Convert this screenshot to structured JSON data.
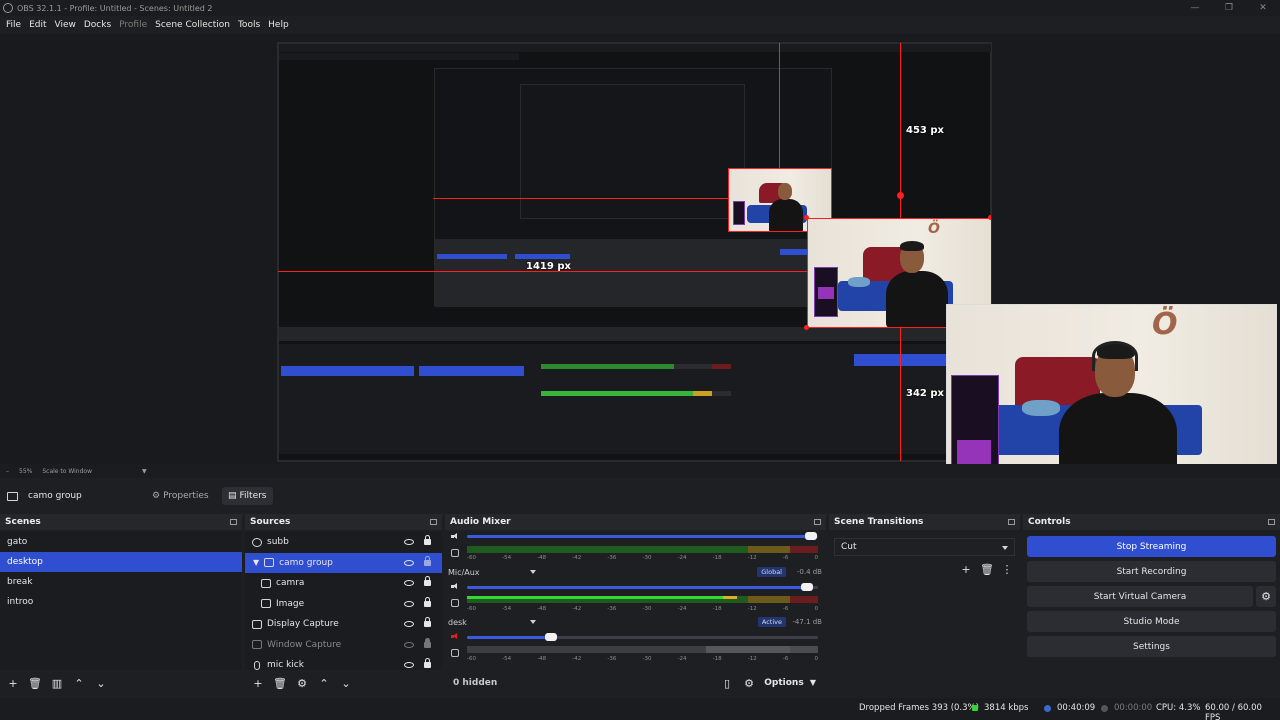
{
  "window": {
    "title": "OBS 32.1.1 - Profile: Untitled - Scenes: Untitled 2",
    "controls": [
      "—",
      "❐",
      "✕"
    ]
  },
  "menu": [
    "File",
    "Edit",
    "View",
    "Docks",
    "Profile",
    "Scene Collection",
    "Tools",
    "Help"
  ],
  "preview": {
    "measure_top": "453 px",
    "measure_left": "1419 px",
    "measure_right": "342 px",
    "zoom": "55%",
    "scale_mode": "Scale to Window"
  },
  "context": {
    "source_name": "camo group",
    "properties_label": "Properties",
    "filters_label": "Filters"
  },
  "scenes": {
    "title": "Scenes",
    "items": [
      "gato",
      "desktop",
      "break",
      "introo"
    ],
    "selected_index": 1
  },
  "sources": {
    "title": "Sources",
    "items": [
      {
        "label": "subb",
        "icon": "browser-icon"
      },
      {
        "label": "camo group",
        "icon": "group-icon"
      },
      {
        "label": "camra",
        "icon": "camera-icon"
      },
      {
        "label": "Image",
        "icon": "image-icon"
      },
      {
        "label": "Display Capture",
        "icon": "monitor-icon"
      },
      {
        "label": "Window Capture",
        "icon": "window-icon"
      },
      {
        "label": "mic kick",
        "icon": "mic-icon"
      }
    ],
    "selected_index": 1
  },
  "audio_mixer": {
    "title": "Audio Mixer",
    "scale": [
      "-60",
      "-54",
      "-48",
      "-42",
      "-36",
      "-30",
      "-24",
      "-18",
      "-12",
      "-6",
      "0"
    ],
    "channels": [
      {
        "name": "",
        "badge": "",
        "db": "",
        "volume": 1.0
      },
      {
        "name": "Mic/Aux",
        "badge": "Global",
        "db": "-0.4 dB",
        "volume": 0.97
      },
      {
        "name": "desk",
        "badge": "Active",
        "db": "-47.1 dB",
        "volume": 0.24
      }
    ],
    "hidden_label": "0 hidden",
    "options_label": "Options"
  },
  "scene_transitions": {
    "title": "Scene Transitions",
    "selected": "Cut"
  },
  "controls": {
    "title": "Controls",
    "buttons": [
      "Stop Streaming",
      "Start Recording",
      "Start Virtual Camera",
      "Studio Mode",
      "Settings"
    ]
  },
  "status": {
    "dropped_frames": "Dropped Frames 393 (0.3%)",
    "bitrate": "3814 kbps",
    "stream_time": "00:40:09",
    "record_time": "00:00:00",
    "cpu": "CPU: 4.3%",
    "fps": "60.00 / 60.00 FPS"
  },
  "colors": {
    "accent": "#2f4fd0",
    "guide": "#ff1f1f",
    "live": "#33d633"
  }
}
